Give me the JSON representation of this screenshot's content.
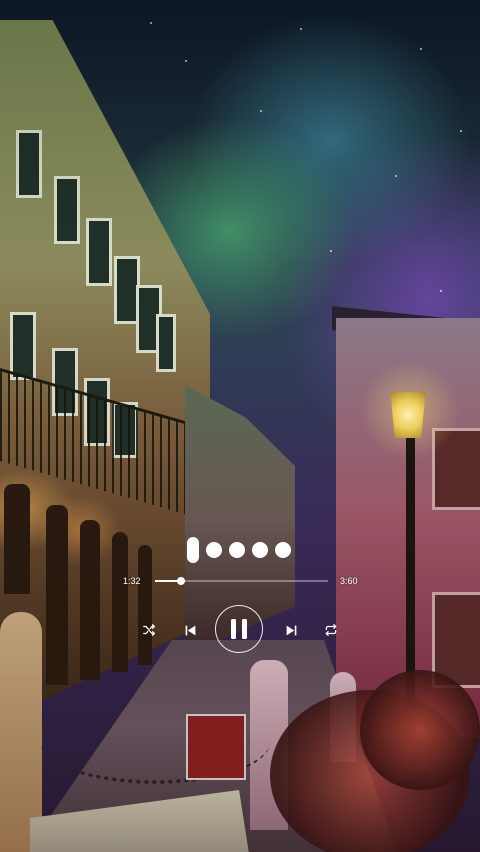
{
  "player": {
    "elapsed": "1:32",
    "total": "3:60",
    "progress": 0.15,
    "lyrics_indicator": "loading-dots",
    "controls": {
      "shuffle_icon": "shuffle-icon",
      "previous_icon": "skip-previous-icon",
      "play_pause_icon": "pause-icon",
      "next_icon": "skip-next-icon",
      "repeat_icon": "repeat-icon"
    },
    "state": "playing"
  },
  "background": {
    "description_colors": {
      "sky_green": "#46a06e",
      "sky_purple": "#6e46aa",
      "lamp_yellow": "#f2d25a"
    }
  }
}
